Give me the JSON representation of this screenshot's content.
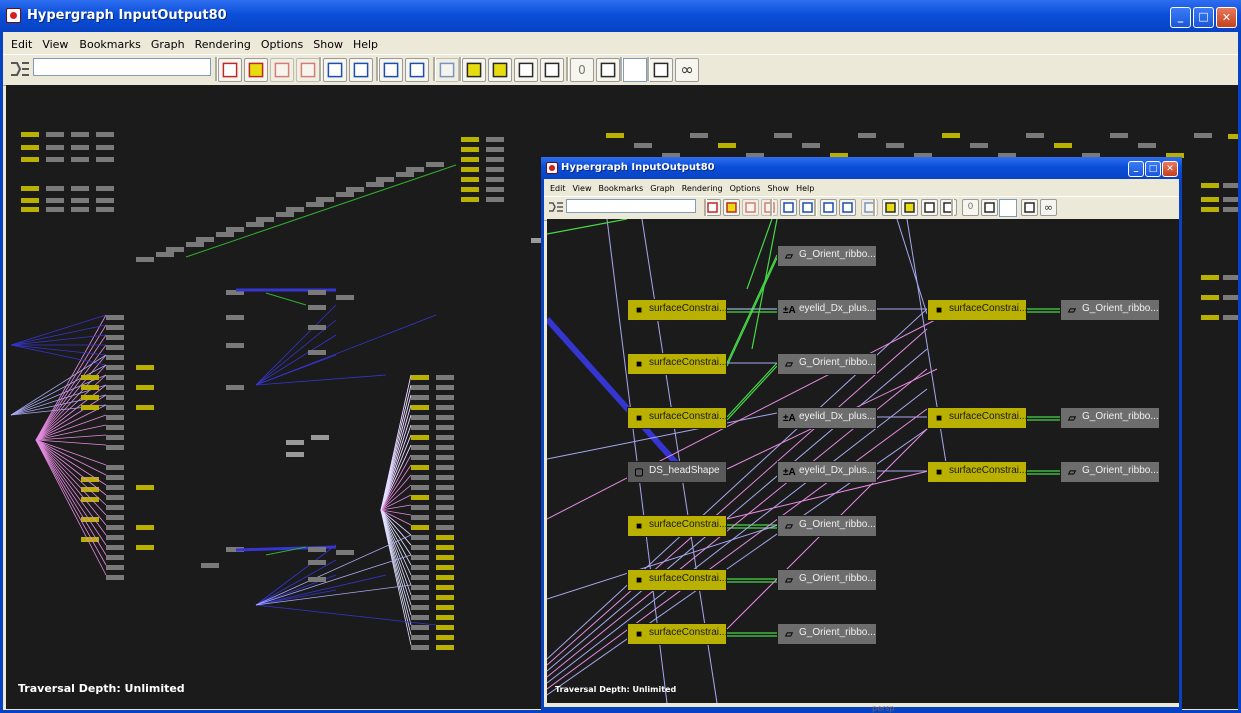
{
  "main_window": {
    "title": "Hypergraph InputOutput80",
    "menu": [
      "Edit",
      "View",
      "Bookmarks",
      "Graph",
      "Rendering",
      "Options",
      "Show",
      "Help"
    ],
    "footer": "Traversal Depth: Unlimited",
    "buttons": {
      "minimize": "_",
      "maximize": "□",
      "close": "✕"
    }
  },
  "inner_window": {
    "title": "Hypergraph InputOutput80",
    "menu": [
      "Edit",
      "View",
      "Bookmarks",
      "Graph",
      "Rendering",
      "Options",
      "Show",
      "Help"
    ],
    "footer": "Traversal Depth: Unlimited",
    "buttons": {
      "minimize": "_",
      "maximize": "□",
      "close": "✕"
    }
  },
  "toolbar_icons": [
    "scene-hierarchy",
    "input-output",
    "select-up",
    "select-down",
    "graph-up",
    "graph-down",
    "create-bookmark",
    "bookmark-editor",
    "layout",
    "frame-all",
    "frame-selection",
    "frame-hierarchy",
    "frame-branch",
    "zero-depth",
    "decrease-depth",
    "increase-depth",
    "unlimited-depth"
  ],
  "toolbar_zero_label": "0",
  "toolbar_infinity_label": "∞",
  "nodes": {
    "surface_constraint": "surfaceConstrai...",
    "orient_ribbon": "G_Orient_ribbo...",
    "eyelid_plus": "eyelid_Dx_plus...",
    "head_shape": "DS_headShape"
  },
  "bottom_label": "persp",
  "node_icons": {
    "constraint": "cube-icon",
    "orient": "parallelogram-icon",
    "plus": "plus-minus-a-icon"
  },
  "colors": {
    "title_blue": "#0a4fd9",
    "canvas": "#1b1b1b",
    "node_yellow": "#b9b000",
    "node_gray": "#6d6d6d",
    "edge_green": "#47d847",
    "edge_pink": "#e58be0",
    "edge_blue": "#3535d0",
    "edge_lavender": "#a8a8f0"
  }
}
